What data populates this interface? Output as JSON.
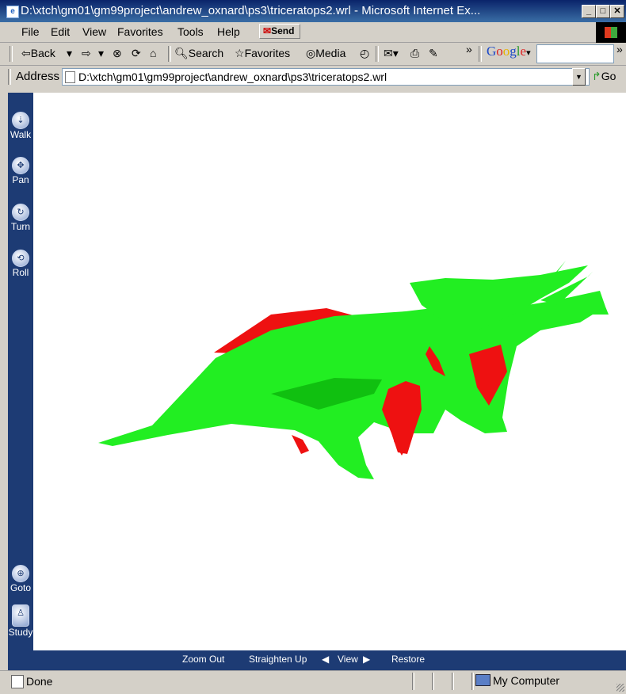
{
  "window": {
    "title": "D:\\xtch\\gm01\\gm99project\\andrew_oxnard\\ps3\\triceratops2.wrl - Microsoft Internet Ex...",
    "minimize": "_",
    "maximize": "□",
    "close": "✕"
  },
  "menu": {
    "items": [
      {
        "label": "File"
      },
      {
        "label": "Edit"
      },
      {
        "label": "View"
      },
      {
        "label": "Favorites"
      },
      {
        "label": "Tools"
      },
      {
        "label": "Help"
      }
    ],
    "send_label": "Send"
  },
  "toolbar": {
    "back": "Back",
    "search": "Search",
    "favorites": "Favorites",
    "media": "Media",
    "overflow": "»",
    "google_letters": [
      "G",
      "o",
      "o",
      "g",
      "l",
      "e"
    ],
    "google_search_value": ""
  },
  "address": {
    "label": "Address",
    "value": "D:\\xtch\\gm01\\gm99project\\andrew_oxnard\\ps3\\triceratops2.wrl",
    "go": "Go"
  },
  "vrml_nav": {
    "buttons": [
      {
        "label": "Walk"
      },
      {
        "label": "Pan"
      },
      {
        "label": "Turn"
      },
      {
        "label": "Roll"
      },
      {
        "label": "Goto"
      },
      {
        "label": "Study"
      }
    ]
  },
  "vrml_bottom": {
    "zoom_out": "Zoom Out",
    "straighten_up": "Straighten Up",
    "view": "View",
    "restore": "Restore"
  },
  "scene": {
    "model_colors": {
      "body": "#22ee22",
      "body_shadow": "#10c010",
      "frill_back": "#ee1111"
    }
  },
  "status": {
    "text": "Done",
    "zone": "My Computer"
  }
}
